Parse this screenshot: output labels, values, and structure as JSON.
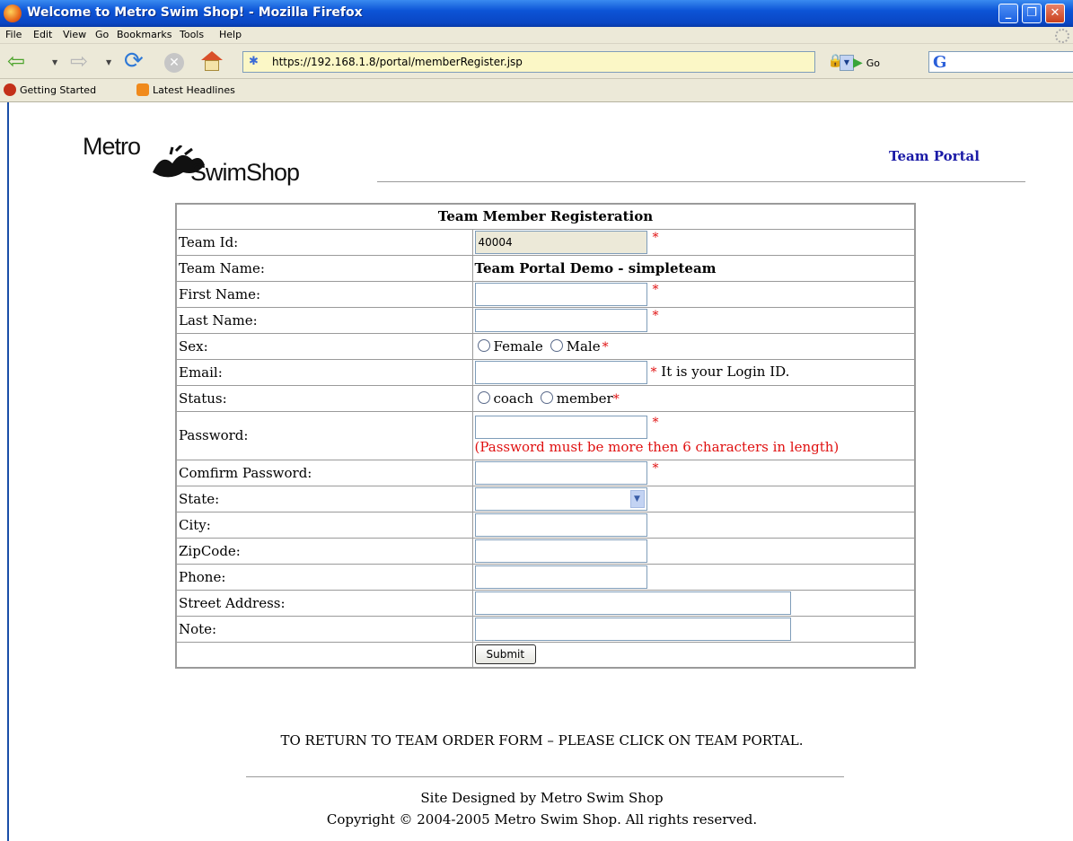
{
  "window": {
    "title": "Welcome to Metro Swim Shop! - Mozilla Firefox"
  },
  "menu": {
    "items": [
      "File",
      "Edit",
      "View",
      "Go",
      "Bookmarks",
      "Tools",
      "Help"
    ]
  },
  "toolbar": {
    "url": "https://192.168.1.8/portal/memberRegister.jsp",
    "go_label": "Go"
  },
  "bookmarks": {
    "items": [
      "Getting Started",
      "Latest Headlines"
    ]
  },
  "header": {
    "logo_top": "Metro",
    "logo_bottom": "SwimShop",
    "team_portal_link": "Team Portal"
  },
  "form": {
    "title": "Team Member Registeration",
    "team_id": {
      "label": "Team Id:",
      "value": "40004"
    },
    "team_name": {
      "label": "Team Name:",
      "value": "Team Portal Demo - simpleteam"
    },
    "first_name": {
      "label": "First Name:"
    },
    "last_name": {
      "label": "Last Name:"
    },
    "sex": {
      "label": "Sex:",
      "options": [
        "Female",
        "Male"
      ]
    },
    "email": {
      "label": "Email:",
      "hint": "It is your Login ID."
    },
    "status": {
      "label": "Status:",
      "options": [
        "coach",
        "member"
      ]
    },
    "password": {
      "label": "Password:",
      "hint": "(Password must be more then 6 characters in length)"
    },
    "confirm_password": {
      "label": "Comfirm Password:"
    },
    "state": {
      "label": "State:",
      "value": ""
    },
    "city": {
      "label": "City:"
    },
    "zipcode": {
      "label": "ZipCode:"
    },
    "phone": {
      "label": "Phone:"
    },
    "street": {
      "label": "Street Address:"
    },
    "note": {
      "label": "Note:"
    },
    "required_mark": "*",
    "submit_label": "Submit"
  },
  "footer": {
    "return_message": "TO RETURN TO TEAM ORDER FORM – PLEASE CLICK ON TEAM PORTAL.",
    "designed_by": "Site Designed by Metro Swim Shop",
    "copyright": "Copyright © 2004-2005 Metro Swim Shop. All rights reserved."
  }
}
